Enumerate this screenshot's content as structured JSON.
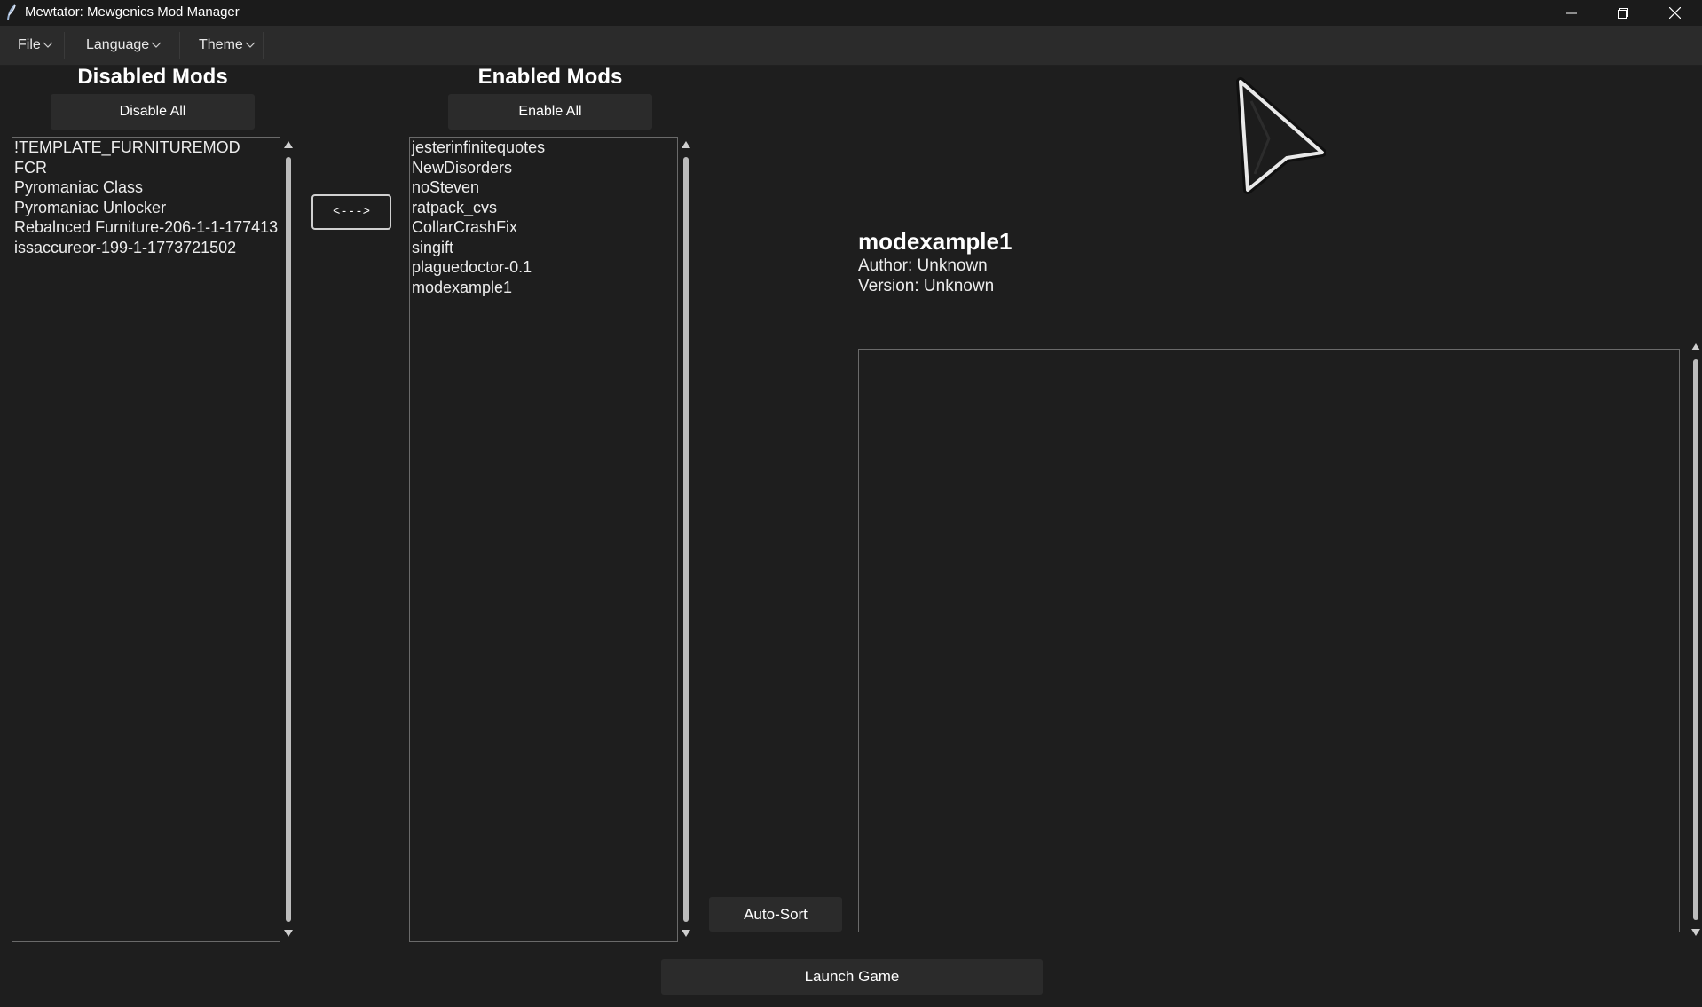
{
  "window": {
    "title": "Mewtator: Mewgenics Mod Manager",
    "icon": "feather-icon",
    "controls": [
      "minimize",
      "restore",
      "close"
    ]
  },
  "menu": {
    "file": "File",
    "language": "Language",
    "theme": "Theme"
  },
  "disabled": {
    "heading": "Disabled Mods",
    "button": "Disable All",
    "items": [
      "!TEMPLATE_FURNITUREMOD",
      "FCR",
      "Pyromaniac Class",
      "Pyromaniac Unlocker",
      "Rebalnced Furniture-206-1-1-177413",
      "issaccureor-199-1-1773721502"
    ]
  },
  "transfer": {
    "label": "<--->"
  },
  "enabled": {
    "heading": "Enabled Mods",
    "button": "Enable All",
    "items": [
      "jesterinfinitequotes",
      "NewDisorders",
      "noSteven",
      "ratpack_cvs",
      "CollarCrashFix",
      "singift",
      "plaguedoctor-0.1",
      "modexample1"
    ]
  },
  "details": {
    "name": "modexample1",
    "author": "Author: Unknown",
    "version": "Version: Unknown",
    "description": ""
  },
  "auto_sort": "Auto-Sort",
  "launch": "Launch Game",
  "colors": {
    "background": "#1e1e1e",
    "titlebar": "#1b1b1b",
    "menubar": "#2b2b2b",
    "button": "#2b2b2b",
    "border": "#6a6a6a",
    "text": "#ffffff"
  }
}
